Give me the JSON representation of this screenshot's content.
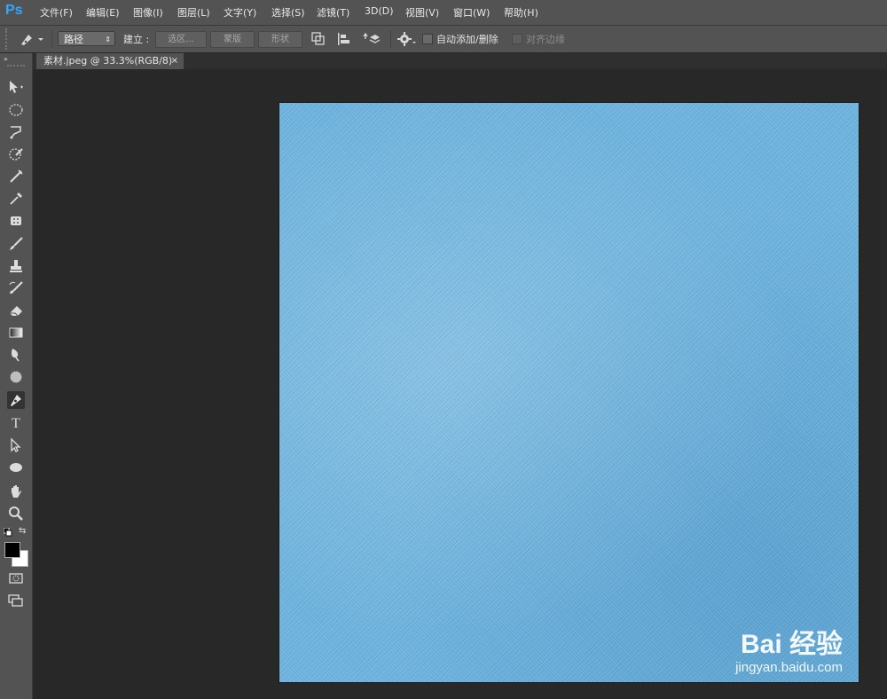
{
  "app": {
    "logo": "Ps"
  },
  "menu": [
    {
      "label": "文件(F)"
    },
    {
      "label": "编辑(E)"
    },
    {
      "label": "图像(I)"
    },
    {
      "label": "图层(L)"
    },
    {
      "label": "文字(Y)"
    },
    {
      "label": "选择(S)"
    },
    {
      "label": "滤镜(T)"
    },
    {
      "label": "3D(D)"
    },
    {
      "label": "视图(V)"
    },
    {
      "label": "窗口(W)"
    },
    {
      "label": "帮助(H)"
    }
  ],
  "options": {
    "mode_select": "路径",
    "build_label": "建立 :",
    "selection_button": "选区...",
    "mask_button": "蒙版",
    "shape_button": "形状",
    "auto_add_delete": "自动添加/删除",
    "align_edges": "对齐边缘"
  },
  "document": {
    "tab_title": "素材.jpeg @ 33.3%(RGB/8)",
    "close_glyph": "×"
  },
  "watermark": {
    "brand": "Bai 经验",
    "url": "jingyan.baidu.com"
  },
  "colors": {
    "foreground": "#000000",
    "background": "#ffffff",
    "canvas_texture": "#6db3dd"
  },
  "tools": [
    "move-icon",
    "marquee-icon",
    "lasso-icon",
    "quick-selection-icon",
    "crop-icon",
    "eyedropper-icon",
    "healing-brush-icon",
    "brush-icon",
    "clone-stamp-icon",
    "history-brush-icon",
    "eraser-icon",
    "gradient-icon",
    "blur-icon",
    "dodge-icon",
    "pen-icon",
    "type-icon",
    "path-selection-icon",
    "ellipse-icon",
    "hand-icon",
    "zoom-icon"
  ]
}
